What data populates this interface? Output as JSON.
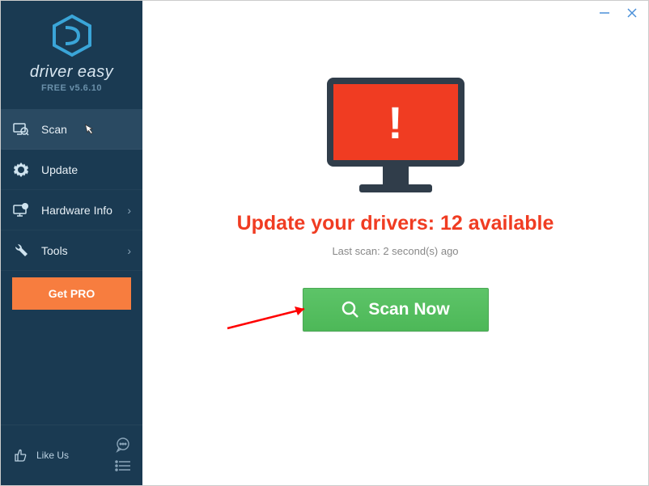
{
  "brand": "driver easy",
  "version": "FREE v5.6.10",
  "nav": {
    "scan": "Scan",
    "update": "Update",
    "hardware": "Hardware Info",
    "tools": "Tools"
  },
  "getPro": "Get PRO",
  "footer": {
    "likeUs": "Like Us"
  },
  "main": {
    "headline": "Update your drivers: 12 available",
    "subline": "Last scan: 2 second(s) ago",
    "scanNow": "Scan Now"
  },
  "colors": {
    "sidebar": "#1a3a52",
    "accent": "#f03c22",
    "pro": "#f77d3f",
    "scan": "#51bb5c"
  }
}
